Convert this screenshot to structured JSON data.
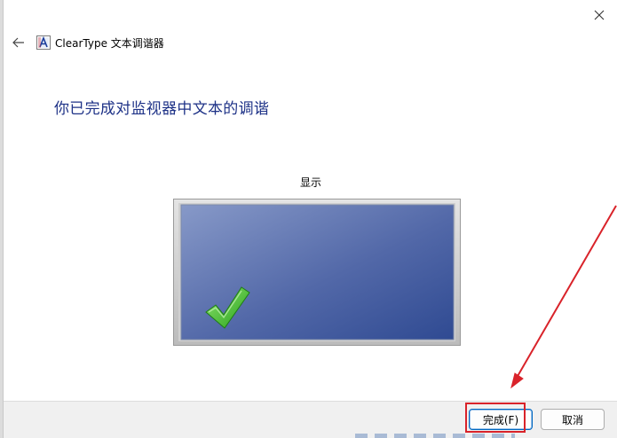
{
  "window": {
    "title": "ClearType 文本调谐器",
    "close_icon": "close-icon",
    "back_icon": "back-arrow-icon",
    "app_icon": "cleartype-app-icon"
  },
  "main": {
    "heading": "你已完成对监视器中文本的调谐",
    "display_label": "显示",
    "monitor_icon": "checkmark-icon"
  },
  "footer": {
    "finish_label": "完成(F)",
    "cancel_label": "取消"
  },
  "colors": {
    "heading": "#1e3287",
    "highlight": "#d9232a",
    "checkmark": "#3fbf2a"
  }
}
